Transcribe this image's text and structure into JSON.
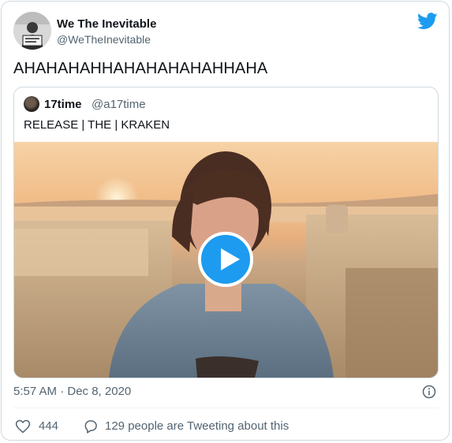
{
  "author": {
    "name": "We The Inevitable",
    "handle": "@WeTheInevitable"
  },
  "tweet": {
    "text": "AHAHAHAHHAHAHAHAHAHHAHA"
  },
  "quoted_tweet": {
    "author_name": "17time",
    "author_handle": "@a17time",
    "text": "RELEASE | THE | KRAKEN",
    "media_type": "video"
  },
  "meta": {
    "timestamp": "5:57 AM · Dec 8, 2020"
  },
  "actions": {
    "like_count": "444",
    "reply_text": "129 people are Tweeting about this"
  },
  "icons": {
    "brand": "twitter-bird-icon",
    "info": "info-icon",
    "like": "heart-icon",
    "reply": "speech-bubble-icon",
    "play": "play-icon"
  },
  "colors": {
    "brand_blue": "#1d9bf0",
    "secondary_text": "#536471",
    "primary_text": "#0f1419",
    "border": "#cfd9de"
  }
}
